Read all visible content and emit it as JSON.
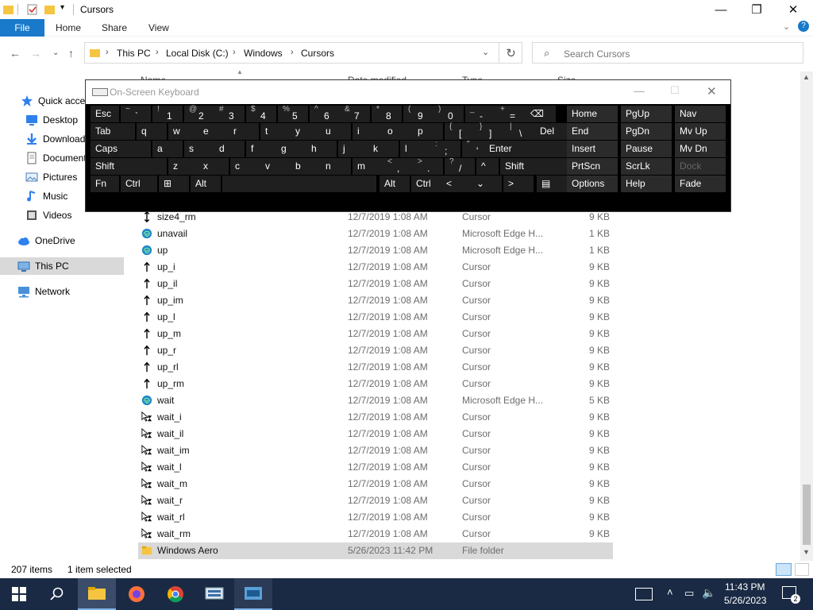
{
  "window": {
    "title": "Cursors"
  },
  "ribbon": {
    "file": "File",
    "tabs": [
      "Home",
      "Share",
      "View"
    ]
  },
  "address": {
    "crumbs": [
      "This PC",
      "Local Disk (C:)",
      "Windows",
      "Cursors"
    ],
    "search_placeholder": "Search Cursors"
  },
  "columns": {
    "name": "Name",
    "date": "Date modified",
    "type": "Type",
    "size": "Size"
  },
  "sidebar": {
    "items": [
      {
        "label": "Quick access",
        "icon": "star-icon"
      },
      {
        "label": "Desktop",
        "icon": "desktop-icon"
      },
      {
        "label": "Downloads",
        "icon": "download-icon"
      },
      {
        "label": "Documents",
        "icon": "documents-icon"
      },
      {
        "label": "Pictures",
        "icon": "pictures-icon"
      },
      {
        "label": "Music",
        "icon": "music-icon"
      },
      {
        "label": "Videos",
        "icon": "videos-icon"
      },
      {
        "label": "OneDrive",
        "icon": "cloud-icon"
      },
      {
        "label": "This PC",
        "icon": "pc-icon"
      },
      {
        "label": "Network",
        "icon": "network-icon"
      }
    ]
  },
  "files": [
    {
      "name": "size4_rm",
      "date": "12/7/2019 1:08 AM",
      "type": "Cursor",
      "size": "9 KB",
      "icon": "cursor-icon"
    },
    {
      "name": "unavail",
      "date": "12/7/2019 1:08 AM",
      "type": "Microsoft Edge H...",
      "size": "1 KB",
      "icon": "edge-icon"
    },
    {
      "name": "up",
      "date": "12/7/2019 1:08 AM",
      "type": "Microsoft Edge H...",
      "size": "1 KB",
      "icon": "edge-icon"
    },
    {
      "name": "up_i",
      "date": "12/7/2019 1:08 AM",
      "type": "Cursor",
      "size": "9 KB",
      "icon": "up-arrow-icon"
    },
    {
      "name": "up_il",
      "date": "12/7/2019 1:08 AM",
      "type": "Cursor",
      "size": "9 KB",
      "icon": "up-arrow-icon"
    },
    {
      "name": "up_im",
      "date": "12/7/2019 1:08 AM",
      "type": "Cursor",
      "size": "9 KB",
      "icon": "up-arrow-icon"
    },
    {
      "name": "up_l",
      "date": "12/7/2019 1:08 AM",
      "type": "Cursor",
      "size": "9 KB",
      "icon": "up-arrow-icon"
    },
    {
      "name": "up_m",
      "date": "12/7/2019 1:08 AM",
      "type": "Cursor",
      "size": "9 KB",
      "icon": "up-arrow-icon"
    },
    {
      "name": "up_r",
      "date": "12/7/2019 1:08 AM",
      "type": "Cursor",
      "size": "9 KB",
      "icon": "up-arrow-icon"
    },
    {
      "name": "up_rl",
      "date": "12/7/2019 1:08 AM",
      "type": "Cursor",
      "size": "9 KB",
      "icon": "up-arrow-icon"
    },
    {
      "name": "up_rm",
      "date": "12/7/2019 1:08 AM",
      "type": "Cursor",
      "size": "9 KB",
      "icon": "up-arrow-icon"
    },
    {
      "name": "wait",
      "date": "12/7/2019 1:08 AM",
      "type": "Microsoft Edge H...",
      "size": "5 KB",
      "icon": "edge-icon"
    },
    {
      "name": "wait_i",
      "date": "12/7/2019 1:08 AM",
      "type": "Cursor",
      "size": "9 KB",
      "icon": "wait-cursor-icon"
    },
    {
      "name": "wait_il",
      "date": "12/7/2019 1:08 AM",
      "type": "Cursor",
      "size": "9 KB",
      "icon": "wait-cursor-icon"
    },
    {
      "name": "wait_im",
      "date": "12/7/2019 1:08 AM",
      "type": "Cursor",
      "size": "9 KB",
      "icon": "wait-cursor-icon"
    },
    {
      "name": "wait_l",
      "date": "12/7/2019 1:08 AM",
      "type": "Cursor",
      "size": "9 KB",
      "icon": "wait-cursor-icon"
    },
    {
      "name": "wait_m",
      "date": "12/7/2019 1:08 AM",
      "type": "Cursor",
      "size": "9 KB",
      "icon": "wait-cursor-icon"
    },
    {
      "name": "wait_r",
      "date": "12/7/2019 1:08 AM",
      "type": "Cursor",
      "size": "9 KB",
      "icon": "wait-cursor-icon"
    },
    {
      "name": "wait_rl",
      "date": "12/7/2019 1:08 AM",
      "type": "Cursor",
      "size": "9 KB",
      "icon": "wait-cursor-icon"
    },
    {
      "name": "wait_rm",
      "date": "12/7/2019 1:08 AM",
      "type": "Cursor",
      "size": "9 KB",
      "icon": "wait-cursor-icon"
    },
    {
      "name": "Windows Aero",
      "date": "5/26/2023 11:42 PM",
      "type": "File folder",
      "size": "",
      "icon": "folder-icon",
      "selected": true
    }
  ],
  "osk": {
    "title": "On-Screen Keyboard",
    "rows": [
      [
        {
          "k": "Esc"
        },
        {
          "k": "`",
          "s": "~"
        },
        {
          "k": "1",
          "s": "!"
        },
        {
          "k": "2",
          "s": "@"
        },
        {
          "k": "3",
          "s": "#"
        },
        {
          "k": "4",
          "s": "$"
        },
        {
          "k": "5",
          "s": "%"
        },
        {
          "k": "6",
          "s": "^"
        },
        {
          "k": "7",
          "s": "&"
        },
        {
          "k": "8",
          "s": "*"
        },
        {
          "k": "9",
          "s": "("
        },
        {
          "k": "0",
          "s": ")"
        },
        {
          "k": "-",
          "s": "_"
        },
        {
          "k": "=",
          "s": "+"
        },
        {
          "k": "⌫"
        }
      ],
      [
        {
          "k": "Tab"
        },
        {
          "k": "q"
        },
        {
          "k": "w"
        },
        {
          "k": "e"
        },
        {
          "k": "r"
        },
        {
          "k": "t"
        },
        {
          "k": "y"
        },
        {
          "k": "u"
        },
        {
          "k": "i"
        },
        {
          "k": "o"
        },
        {
          "k": "p"
        },
        {
          "k": "[",
          "s": "{"
        },
        {
          "k": "]",
          "s": "}"
        },
        {
          "k": "\\",
          "s": "|"
        },
        {
          "k": "Del"
        }
      ],
      [
        {
          "k": "Caps"
        },
        {
          "k": "a"
        },
        {
          "k": "s"
        },
        {
          "k": "d"
        },
        {
          "k": "f"
        },
        {
          "k": "g"
        },
        {
          "k": "h"
        },
        {
          "k": "j"
        },
        {
          "k": "k"
        },
        {
          "k": "l"
        },
        {
          "k": ";",
          "s": ":"
        },
        {
          "k": "'",
          "s": "\""
        },
        {
          "k": "Enter"
        }
      ],
      [
        {
          "k": "Shift"
        },
        {
          "k": "z"
        },
        {
          "k": "x"
        },
        {
          "k": "c"
        },
        {
          "k": "v"
        },
        {
          "k": "b"
        },
        {
          "k": "n"
        },
        {
          "k": "m"
        },
        {
          "k": ",",
          "s": "<"
        },
        {
          "k": ".",
          "s": ">"
        },
        {
          "k": "/",
          "s": "?"
        },
        {
          "k": "^"
        },
        {
          "k": "Shift"
        }
      ],
      [
        {
          "k": "Fn"
        },
        {
          "k": "Ctrl"
        },
        {
          "k": "⊞"
        },
        {
          "k": "Alt"
        },
        {
          "k": ""
        },
        {
          "k": "Alt"
        },
        {
          "k": "Ctrl"
        },
        {
          "k": "<"
        },
        {
          "k": "⌄"
        },
        {
          "k": ">"
        },
        {
          "k": "▤"
        }
      ]
    ],
    "nav": [
      [
        "Home",
        "PgUp",
        "Nav"
      ],
      [
        "End",
        "PgDn",
        "Mv Up"
      ],
      [
        "Insert",
        "Pause",
        "Mv Dn"
      ],
      [
        "PrtScn",
        "ScrLk",
        "Dock"
      ],
      [
        "Options",
        "Help",
        "Fade"
      ]
    ]
  },
  "status": {
    "count": "207 items",
    "selected": "1 item selected"
  },
  "taskbar": {
    "time": "11:43 PM",
    "date": "5/26/2023",
    "notifications": "2"
  },
  "colors": {
    "accent": "#1979ca",
    "selection": "#d9d9d9",
    "taskbar": "#1a2a44",
    "osk_key": "#1f1f1f"
  }
}
